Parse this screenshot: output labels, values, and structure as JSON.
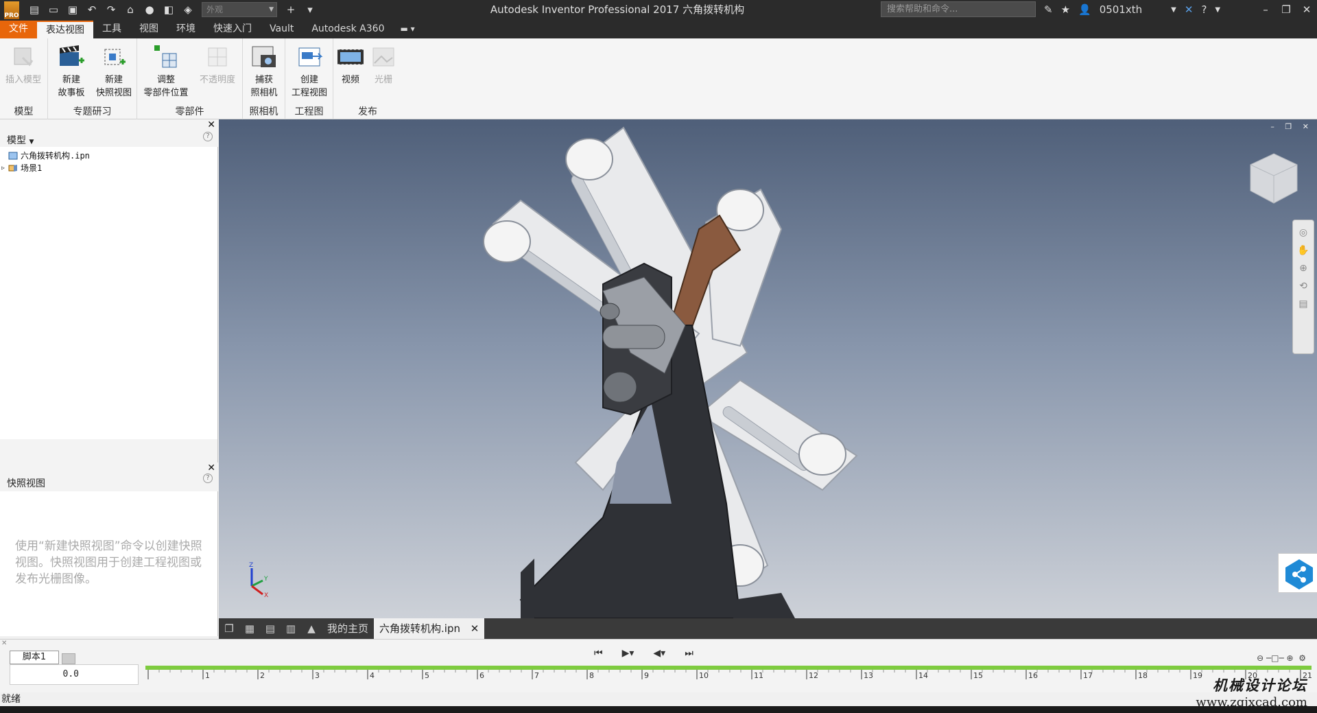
{
  "app": {
    "title": "Autodesk Inventor Professional 2017    六角拨转机构",
    "icon_label": "PRO",
    "material_placeholder": "外观",
    "search_placeholder": "搜索帮助和命令...",
    "user": "0501xth"
  },
  "tabs": [
    {
      "label": "文件"
    },
    {
      "label": "表达视图"
    },
    {
      "label": "工具"
    },
    {
      "label": "视图"
    },
    {
      "label": "环境"
    },
    {
      "label": "快速入门"
    },
    {
      "label": "Vault"
    },
    {
      "label": "Autodesk A360"
    }
  ],
  "ribbon": {
    "model": {
      "label": "模型",
      "insert": "插入模型"
    },
    "topic": {
      "label": "专题研习",
      "new_storyboard": "新建\n故事板",
      "new_snapshot": "新建\n快照视图"
    },
    "parts": {
      "label": "零部件",
      "tweak": "调整\n零部件位置",
      "opacity": "不透明度"
    },
    "camera": {
      "label": "照相机",
      "capture": "捕获\n照相机"
    },
    "drawing": {
      "label": "工程图",
      "create": "创建\n工程视图"
    },
    "publish": {
      "label": "发布",
      "video": "视频",
      "raster": "光栅"
    }
  },
  "model_panel": {
    "title": "模型",
    "tree": [
      {
        "label": "六角拨转机构.ipn"
      },
      {
        "label": "场景1"
      }
    ]
  },
  "snapshot_panel": {
    "title": "快照视图",
    "hint": "使用“新建快照视图”命令以创建快照视图。快照视图用于创建工程视图或发布光栅图像。"
  },
  "triad": {
    "z": "Z",
    "y": "Y",
    "x": "X"
  },
  "doc_tabs": {
    "home": "我的主页",
    "active": "六角拨转机构.ipn"
  },
  "storyboard": {
    "tab": "脚本1",
    "time": "0.0",
    "ticks": [
      "1",
      "2",
      "3",
      "4",
      "5",
      "6",
      "7",
      "8",
      "9",
      "10",
      "11",
      "12",
      "13",
      "14",
      "15",
      "16",
      "17",
      "18",
      "19",
      "20",
      "21"
    ]
  },
  "status": "就绪",
  "watermark": {
    "line1": "机械设计论坛",
    "line2": "www.zgjxcad.com"
  },
  "colors": {
    "accent": "#e8660b",
    "titlebar": "#2b2b2b",
    "timeline_green": "#7ecb3f"
  }
}
